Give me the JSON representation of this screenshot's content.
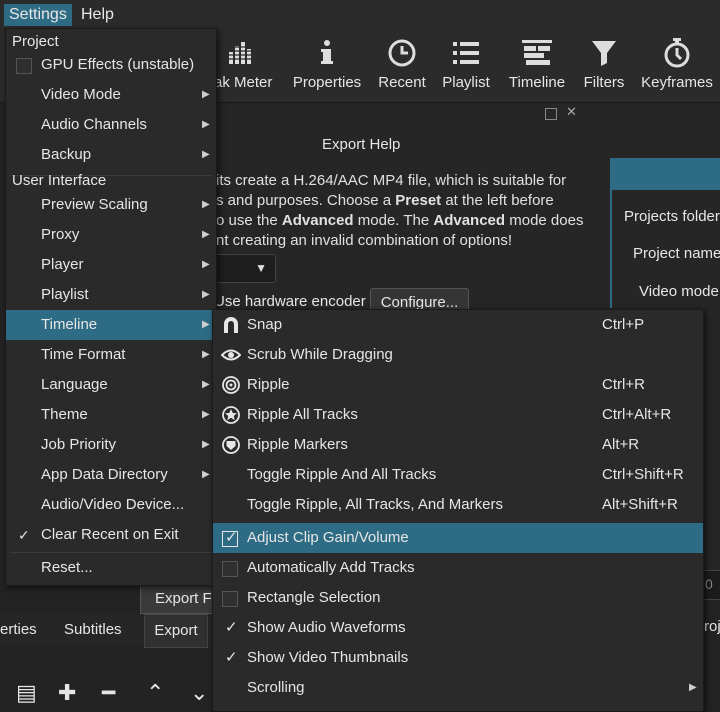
{
  "menubar": {
    "settings": "Settings",
    "help": "Help"
  },
  "toolbar": [
    {
      "label": "ak Meter",
      "icon": "peak-meter-icon"
    },
    {
      "label": "Properties",
      "icon": "info-icon"
    },
    {
      "label": "Recent",
      "icon": "clock-icon"
    },
    {
      "label": "Playlist",
      "icon": "list-icon"
    },
    {
      "label": "Timeline",
      "icon": "timeline-icon"
    },
    {
      "label": "Filters",
      "icon": "funnel-icon"
    },
    {
      "label": "Keyframes",
      "icon": "stopwatch-icon"
    }
  ],
  "export": {
    "title": "Export Help",
    "lines": [
      "its create a H.264/AAC MP4 file, which is suitable for",
      "s and purposes. Choose a ",
      "o use the ",
      "nt creating an invalid combination of options!"
    ],
    "line2_bold": "Preset",
    "line2_rest": " at the left before",
    "line3_bold1": "Advanced",
    "line3_mid": " mode. The ",
    "line3_bold2": "Advanced",
    "line3_rest": " mode does",
    "hw_encoder": "Use hardware encoder",
    "configure": "Configure...",
    "export_file": "Export Fi"
  },
  "right_panel": {
    "projects_folder": "Projects folder",
    "project_name": "Project name",
    "video_mode": "Video mode"
  },
  "bottom_tabs": {
    "properties": "erties",
    "subtitles": "Subtitles",
    "export": "Export"
  },
  "right_side": "roje",
  "right_side_field": "0",
  "settings_menu": {
    "project_section": "Project",
    "ui_section": "User Interface",
    "items": [
      {
        "label": "GPU Effects (unstable)"
      },
      {
        "label": "Video Mode"
      },
      {
        "label": "Audio Channels"
      },
      {
        "label": "Backup"
      },
      {
        "label": "Preview Scaling"
      },
      {
        "label": "Proxy"
      },
      {
        "label": "Player"
      },
      {
        "label": "Playlist"
      },
      {
        "label": "Timeline"
      },
      {
        "label": "Time Format"
      },
      {
        "label": "Language"
      },
      {
        "label": "Theme"
      },
      {
        "label": "Job Priority"
      },
      {
        "label": "App Data Directory"
      },
      {
        "label": "Audio/Video Device..."
      },
      {
        "label": "Clear Recent on Exit"
      },
      {
        "label": "Reset..."
      }
    ],
    "checkmark": "✓"
  },
  "timeline_menu": {
    "items": [
      {
        "label": "Snap",
        "shortcut": "Ctrl+P",
        "icon": "magnet-icon"
      },
      {
        "label": "Scrub While Dragging",
        "shortcut": "",
        "icon": "eye-icon"
      },
      {
        "label": "Ripple",
        "shortcut": "Ctrl+R",
        "icon": "ripple-icon"
      },
      {
        "label": "Ripple All Tracks",
        "shortcut": "Ctrl+Alt+R",
        "icon": "ripple-all-tracks-icon"
      },
      {
        "label": "Ripple Markers",
        "shortcut": "Alt+R",
        "icon": "ripple-markers-icon"
      },
      {
        "label": "Toggle Ripple And All Tracks",
        "shortcut": "Ctrl+Shift+R"
      },
      {
        "label": "Toggle Ripple, All Tracks, And Markers",
        "shortcut": "Alt+Shift+R"
      },
      {
        "label": "Adjust Clip Gain/Volume",
        "shortcut": "",
        "checked": true
      },
      {
        "label": "Automatically Add Tracks",
        "shortcut": "",
        "checked": false
      },
      {
        "label": "Rectangle Selection",
        "shortcut": "",
        "checked": false
      },
      {
        "label": "Show Audio Waveforms",
        "shortcut": "",
        "checked": true
      },
      {
        "label": "Show Video Thumbnails",
        "shortcut": "",
        "checked": true
      },
      {
        "label": "Scrolling",
        "shortcut": ""
      }
    ],
    "checkmark": "✓"
  },
  "colors": {
    "accent": "#2e6b84",
    "menu_bg": "#2a2a2a",
    "app_bg": "#232323"
  }
}
